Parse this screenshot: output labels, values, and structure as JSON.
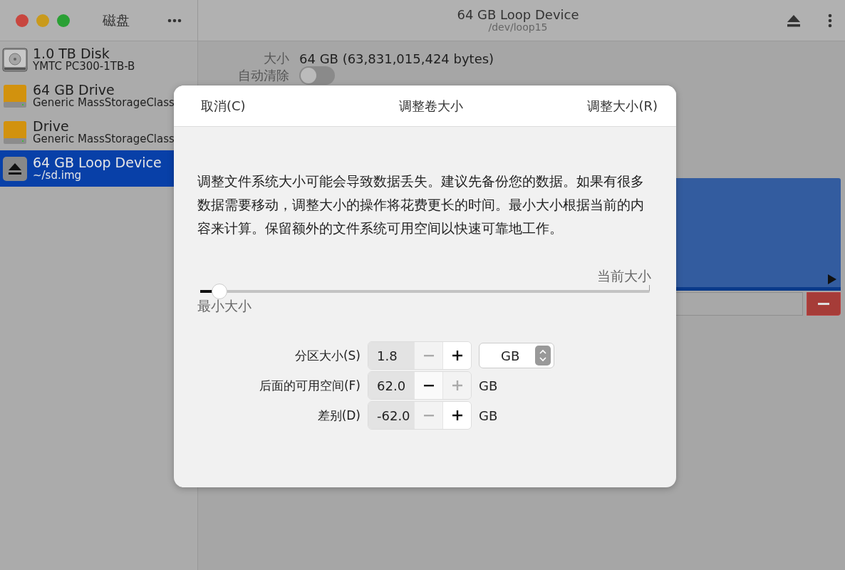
{
  "sidebar": {
    "title": "磁盘",
    "items": [
      {
        "kind": "hdd",
        "name": "1.0 TB Disk",
        "detail": "YMTC PC300-1TB-B",
        "selected": false
      },
      {
        "kind": "usb",
        "name": "64 GB Drive",
        "detail": "Generic MassStorageClass",
        "selected": false
      },
      {
        "kind": "usb",
        "name": "Drive",
        "detail": "Generic MassStorageClass",
        "selected": false
      },
      {
        "kind": "loop",
        "name": "64 GB Loop Device",
        "detail": "~/sd.img",
        "selected": true
      }
    ]
  },
  "header": {
    "title": "64 GB Loop Device",
    "subtitle": "/dev/loop15"
  },
  "details": {
    "size_label": "大小",
    "size_value": "64 GB (63,831,015,424 bytes)",
    "auto_clear_label": "自动清除",
    "auto_clear_on": false
  },
  "dialog": {
    "cancel": "取消(C)",
    "title": "调整卷大小",
    "confirm": "调整大小(R)",
    "message": "调整文件系统大小可能会导致数据丢失。建议先备份您的数据。如果有很多数据需要移动，调整大小的操作将花费更长的时间。最小大小根据当前的内容来计算。保留额外的文件系统可用空间以快速可靠地工作。",
    "slider": {
      "level": 0.03,
      "max_label": "当前大小",
      "min_label": "最小大小"
    },
    "fields": [
      {
        "label": "分区大小(S)",
        "value": "1.8",
        "minus_disabled": true,
        "plus_disabled": false,
        "kind": "select",
        "unit": "GB"
      },
      {
        "label": "后面的可用空间(F)",
        "value": "62.0",
        "minus_disabled": false,
        "plus_disabled": true,
        "kind": "text",
        "unit": "GB"
      },
      {
        "label": "差别(D)",
        "value": "-62.0",
        "minus_disabled": true,
        "plus_disabled": false,
        "kind": "text",
        "unit": "GB"
      }
    ]
  }
}
